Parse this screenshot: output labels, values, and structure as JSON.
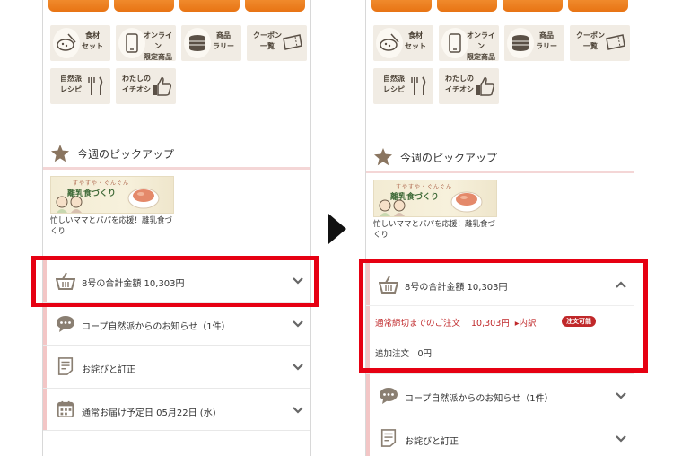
{
  "colors": {
    "highlight": "#e60012",
    "accent_orange": "#e87414",
    "order_red": "#c0282a",
    "icon_gray": "#8a7f72",
    "star_brown": "#8a7560"
  },
  "menu_tiles": [
    {
      "label": "食材\nセット",
      "icon": "bowl-icon"
    },
    {
      "label": "オンライン\n限定商品",
      "icon": "phone-icon"
    },
    {
      "label": "商品\nラリー",
      "icon": "coin-stack-icon"
    },
    {
      "label": "クーポン\n一覧",
      "icon": "coupon-icon"
    },
    {
      "label": "自然派\nレシピ",
      "icon": "fork-knife-icon"
    },
    {
      "label": "わたしの\nイチオシ",
      "icon": "thumbs-up-icon"
    }
  ],
  "pickup": {
    "title": "今週のピックアップ",
    "banner_ruby": "すやすや・ぐんぐん",
    "banner_title": "離乳食づくり",
    "caption": "忙しいママとパパを応援！離乳食づくり"
  },
  "left": {
    "cart_total": "8号の合計金額 10,303円",
    "notice": "コープ自然派からのお知らせ（1件）",
    "apology": "お詫びと訂正",
    "delivery": "通常お届け予定日 05月22日 (水)"
  },
  "right": {
    "cart_total": "8号の合計金額 10,303円",
    "order_label": "通常締切までのご注文",
    "order_amount": "10,303円",
    "breakdown_link": "▸内訳",
    "order_badge": "注文可能",
    "additional": "追加注文　0円",
    "notice": "コープ自然派からのお知らせ（1件）",
    "apology": "お詫びと訂正"
  }
}
